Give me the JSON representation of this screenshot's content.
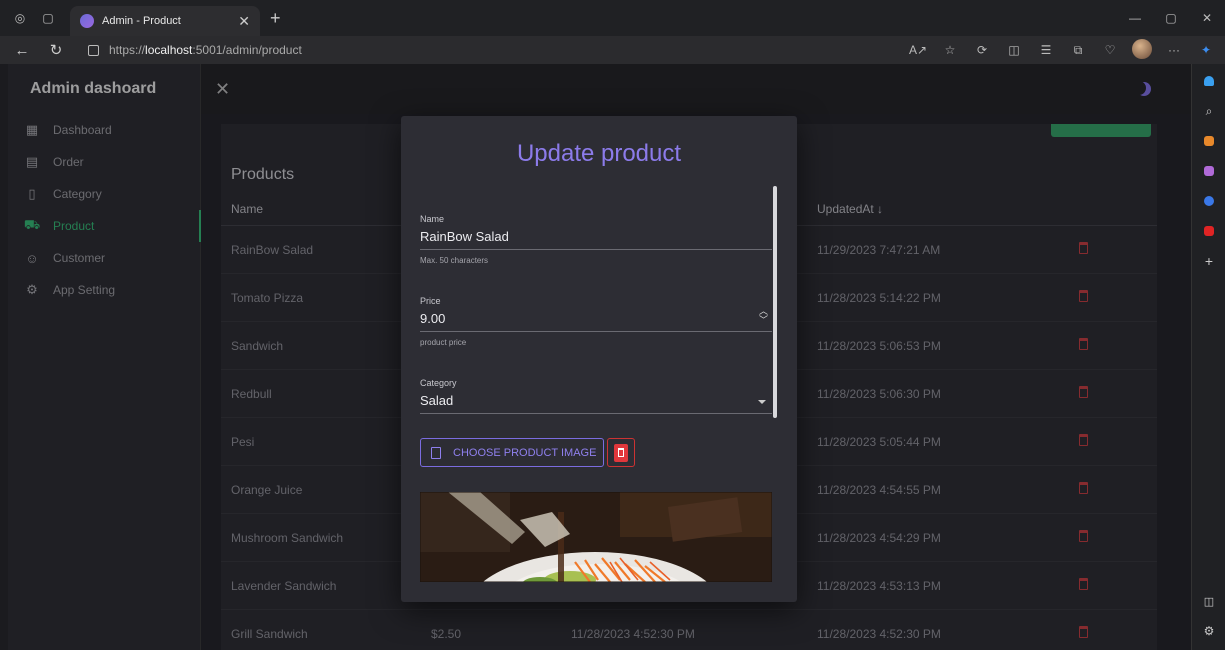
{
  "browser": {
    "tab_title": "Admin - Product",
    "url_prefix": "https://",
    "url_host": "localhost",
    "url_path": ":5001/admin/product"
  },
  "app": {
    "brand": "Admin dashoard",
    "menu": [
      {
        "label": "Dashboard",
        "icon": "dashboard-icon"
      },
      {
        "label": "Order",
        "icon": "order-icon"
      },
      {
        "label": "Category",
        "icon": "category-icon"
      },
      {
        "label": "Product",
        "icon": "cart-icon",
        "active": true
      },
      {
        "label": "Customer",
        "icon": "customer-icon"
      },
      {
        "label": "App Setting",
        "icon": "gear-icon"
      }
    ]
  },
  "products": {
    "title": "Products",
    "headers": {
      "name": "Name",
      "updated": "UpdatedAt ↓"
    },
    "rows": [
      {
        "name": "RainBow Salad",
        "price": "",
        "created": "",
        "updated": "11/29/2023 7:47:21 AM"
      },
      {
        "name": "Tomato Pizza",
        "price": "",
        "created": "",
        "updated": "11/28/2023 5:14:22 PM"
      },
      {
        "name": "Sandwich",
        "price": "",
        "created": "",
        "updated": "11/28/2023 5:06:53 PM"
      },
      {
        "name": "Redbull",
        "price": "",
        "created": "",
        "updated": "11/28/2023 5:06:30 PM"
      },
      {
        "name": "Pesi",
        "price": "",
        "created": "",
        "updated": "11/28/2023 5:05:44 PM"
      },
      {
        "name": "Orange Juice",
        "price": "",
        "created": "",
        "updated": "11/28/2023 4:54:55 PM"
      },
      {
        "name": "Mushroom Sandwich",
        "price": "",
        "created": "",
        "updated": "11/28/2023 4:54:29 PM"
      },
      {
        "name": "Lavender Sandwich",
        "price": "",
        "created": "",
        "updated": "11/28/2023 4:53:13 PM"
      },
      {
        "name": "Grill Sandwich",
        "price": "$2.50",
        "created": "11/28/2023 4:52:30 PM",
        "updated": "11/28/2023 4:52:30 PM"
      }
    ]
  },
  "modal": {
    "title": "Update product",
    "name": {
      "label": "Name",
      "value": "RainBow Salad",
      "help": "Max. 50 characters"
    },
    "price": {
      "label": "Price",
      "value": "9.00",
      "help": "product price"
    },
    "category": {
      "label": "Category",
      "value": "Salad"
    },
    "choose_label": "CHOOSE PRODUCT IMAGE"
  },
  "colors": {
    "accent_green": "#2eb872",
    "accent_purple": "#8c7bea",
    "danger": "#e0373c"
  }
}
